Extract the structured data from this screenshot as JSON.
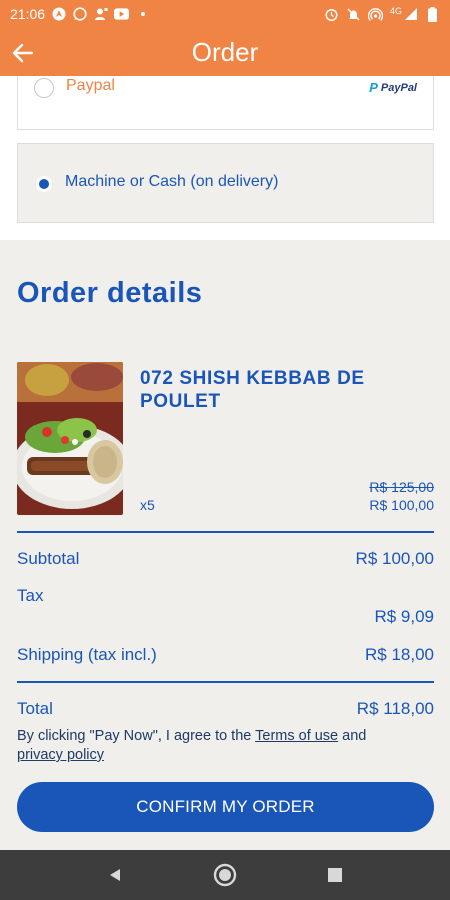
{
  "status_bar": {
    "time": "21:06",
    "signal_label": "4G"
  },
  "header": {
    "title": "Order"
  },
  "payment": {
    "options": [
      {
        "label": "Paypal",
        "selected": false,
        "logo_text": "PayPal"
      },
      {
        "label": "Machine or Cash (on delivery)",
        "selected": true
      }
    ]
  },
  "order_details": {
    "title": "Order details",
    "item": {
      "name": "072 SHISH KEBBAB DE POULET",
      "quantity": "x5",
      "old_price": "R$ 125,00",
      "price": "R$ 100,00"
    },
    "summary": {
      "subtotal_label": "Subtotal",
      "subtotal_value": "R$ 100,00",
      "tax_label": "Tax",
      "tax_value": "R$ 9,09",
      "shipping_label": "Shipping (tax incl.)",
      "shipping_value": "R$ 18,00",
      "total_label": "Total",
      "total_value": "R$ 118,00"
    },
    "terms": {
      "prefix": "By clicking \"Pay Now\", I agree to the ",
      "terms_link": "Terms of use",
      "middle": " and",
      "privacy_link": "privacy policy"
    },
    "confirm_label": "CONFIRM MY ORDER"
  },
  "colors": {
    "accent_orange": "#ef8445",
    "primary_blue": "#1a56b8",
    "details_bg": "#f0efec",
    "nav_bg": "#3d3d3d"
  }
}
